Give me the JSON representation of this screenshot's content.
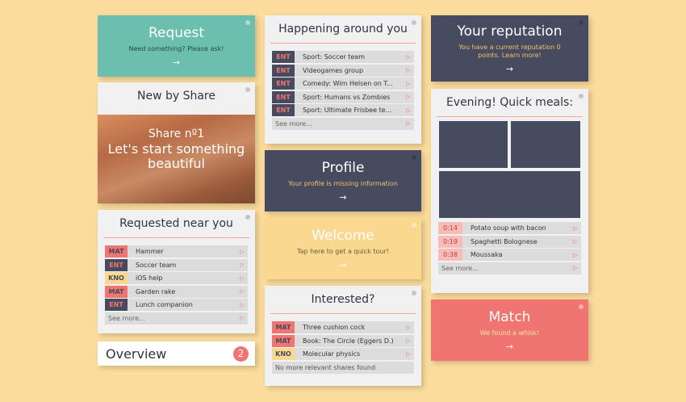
{
  "colors": {
    "background": "#fcdc9c",
    "teal": "#6cbfae",
    "navy": "#474b5f",
    "yellow": "#fad88f",
    "coral": "#f07470",
    "card": "#f1f1f1"
  },
  "arrow": "→",
  "row_arrow": "▷",
  "request": {
    "title": "Request",
    "subtitle": "Need something? Please ask!"
  },
  "new_by_share": {
    "title": "New by Share",
    "photo_line1": "Share nº1",
    "photo_line2": "Let's start something beautiful"
  },
  "requested_near_you": {
    "title": "Requested near you",
    "items": [
      {
        "tag": "MAT",
        "label": "Hammer"
      },
      {
        "tag": "ENT",
        "label": "Soccer team"
      },
      {
        "tag": "KNO",
        "label": "iOS help"
      },
      {
        "tag": "MAT",
        "label": "Garden rake"
      },
      {
        "tag": "ENT",
        "label": "Lunch companion"
      }
    ],
    "more": "See more..."
  },
  "overview": {
    "title": "Overview",
    "count": "2"
  },
  "happening": {
    "title": "Happening around you",
    "items": [
      {
        "tag": "ENT",
        "label": "Sport: Soccer team"
      },
      {
        "tag": "ENT",
        "label": "Videogames group"
      },
      {
        "tag": "ENT",
        "label": "Comedy: Wim Helsen on T..."
      },
      {
        "tag": "ENT",
        "label": "Sport: Humans vs Zombies"
      },
      {
        "tag": "ENT",
        "label": "Sport: Ultimate Frisbee te..."
      }
    ],
    "more": "See more..."
  },
  "profile": {
    "title": "Profile",
    "subtitle": "Your profile is missing information"
  },
  "welcome": {
    "title": "Welcome",
    "subtitle": "Tap here to get a quick tour!"
  },
  "interested": {
    "title": "Interested?",
    "items": [
      {
        "tag": "MAT",
        "label": "Three cushion cock"
      },
      {
        "tag": "MAT",
        "label": "Book: The Circle (Eggers D.)"
      },
      {
        "tag": "KNO",
        "label": "Molecular physics"
      }
    ],
    "footer": "No more relevant shares found"
  },
  "reputation": {
    "title": "Your reputation",
    "subtitle": "You have a current reputation 0 points. Learn more!"
  },
  "meals": {
    "title": "Evening! Quick meals:",
    "items": [
      {
        "time": "0:14",
        "label": "Potato soup with bacon"
      },
      {
        "time": "0:19",
        "label": "Spaghetti Bolognese"
      },
      {
        "time": "0:38",
        "label": "Moussaka"
      }
    ],
    "more": "See more..."
  },
  "match": {
    "title": "Match",
    "subtitle": "We found a whisk!"
  }
}
